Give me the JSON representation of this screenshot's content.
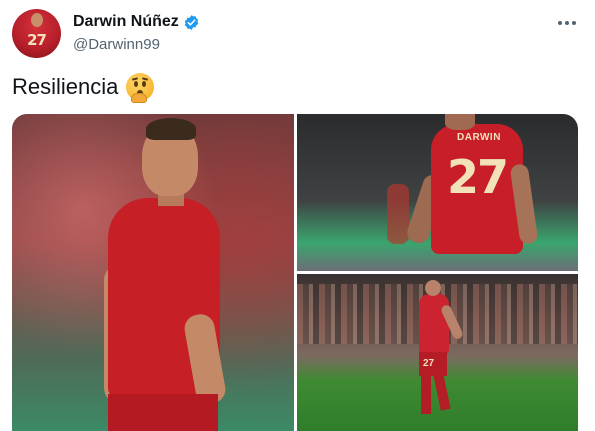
{
  "author": {
    "display_name": "Darwin Núñez",
    "handle": "@Darwinn99",
    "verified": true,
    "avatar_number": "27"
  },
  "tweet": {
    "text": "Resiliencia",
    "emoji": "shushing-face-emoji"
  },
  "media": {
    "images": [
      {
        "description": "player-portrait-left",
        "shirt_text": ""
      },
      {
        "description": "player-back-top-right",
        "shirt_name": "DARWIN",
        "shirt_number": "27"
      },
      {
        "description": "player-walking-bottom-right",
        "shirt_number": "27"
      }
    ]
  },
  "colors": {
    "verified_blue": "#1d9bf0",
    "handle_gray": "#536471",
    "jersey_red": "#c8102e"
  },
  "icons": [
    "verified-badge-icon",
    "more-options-icon"
  ]
}
